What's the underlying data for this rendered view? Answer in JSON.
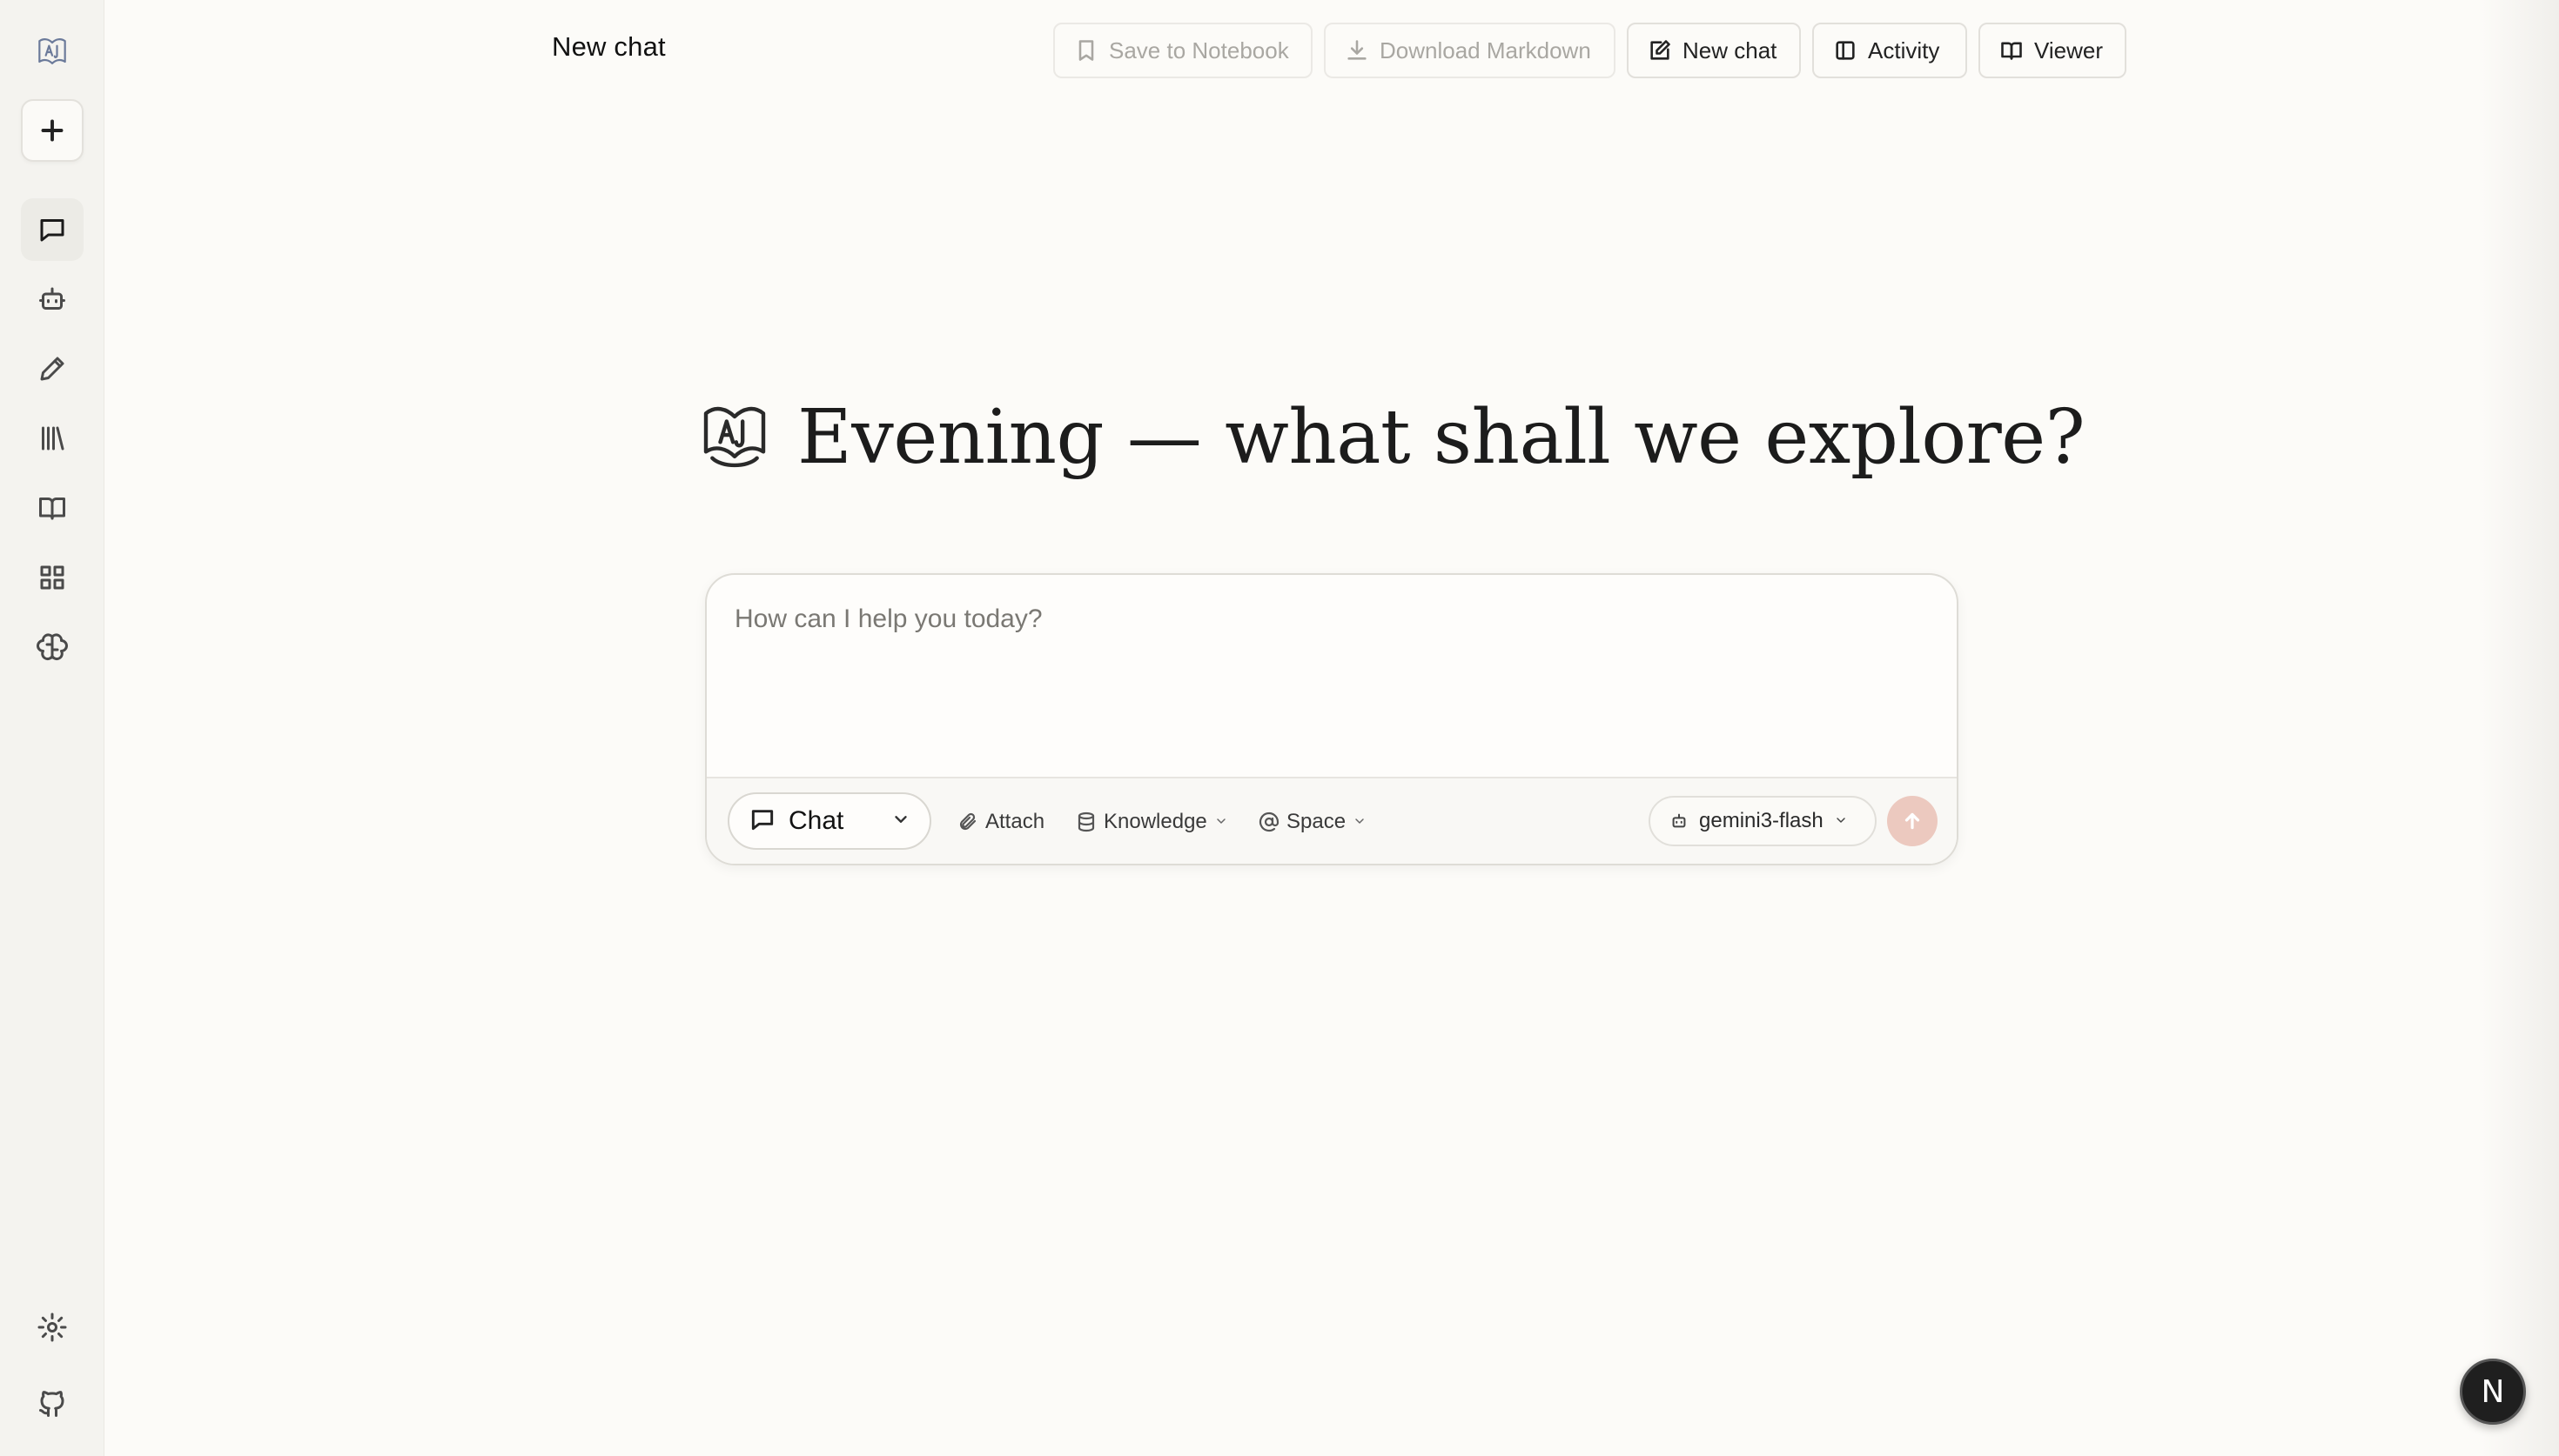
{
  "page": {
    "title": "New chat"
  },
  "sidebar": {
    "items": [
      {
        "name": "logo",
        "icon": "app-logo-icon"
      },
      {
        "name": "new",
        "icon": "plus-icon"
      },
      {
        "name": "chat",
        "icon": "chat-bubble-icon",
        "active": true
      },
      {
        "name": "agents",
        "icon": "bot-icon"
      },
      {
        "name": "write",
        "icon": "pencil-icon"
      },
      {
        "name": "library",
        "icon": "library-icon"
      },
      {
        "name": "notebook",
        "icon": "book-open-icon"
      },
      {
        "name": "apps",
        "icon": "grid-icon"
      },
      {
        "name": "memory",
        "icon": "brain-icon"
      },
      {
        "name": "settings",
        "icon": "gear-icon"
      },
      {
        "name": "github",
        "icon": "github-icon"
      }
    ]
  },
  "toolbar": {
    "save_label": "Save to Notebook",
    "download_label": "Download Markdown",
    "newchat_label": "New chat",
    "activity_label": "Activity",
    "viewer_label": "Viewer"
  },
  "greeting": {
    "text": "Evening — what shall we explore?"
  },
  "composer": {
    "placeholder": "How can I help you today?",
    "mode_label": "Chat",
    "attach_label": "Attach",
    "knowledge_label": "Knowledge",
    "space_label": "Space",
    "model_label": "gemini3-flash"
  },
  "badge": {
    "label": "N"
  },
  "colors": {
    "background": "#fcfbf8",
    "sidebar": "#f4f3ef",
    "send_button": "#ecc9bf"
  }
}
